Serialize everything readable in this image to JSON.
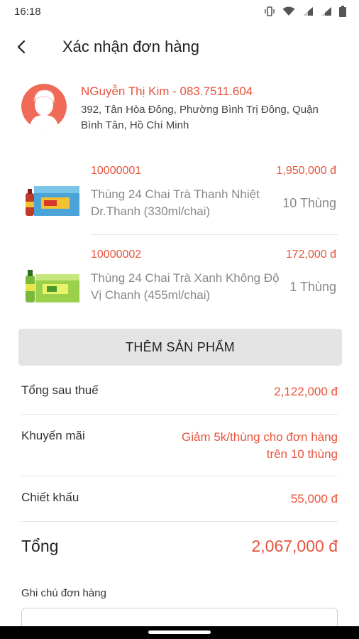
{
  "status_bar": {
    "time": "16:18"
  },
  "header": {
    "title": "Xác nhận đơn hàng"
  },
  "customer": {
    "name": "NGuyễn Thị Kim - 083.7511.604",
    "address": "392, Tân Hòa Đông, Phường Bình Trị Đông, Quận Bình Tân, Hồ Chí Minh"
  },
  "products": [
    {
      "sku": "10000001",
      "price": "1,950,000 đ",
      "name": "Thùng 24 Chai Trà Thanh Nhiệt Dr.Thanh (330ml/chai)",
      "quantity": "10 Thùng"
    },
    {
      "sku": "10000002",
      "price": "172,000 đ",
      "name": "Thùng 24 Chai Trà Xanh Không Độ Vị Chanh (455ml/chai)",
      "quantity": "1 Thùng"
    }
  ],
  "add_product_label": "THÊM SẢN PHẨM",
  "summary": {
    "after_tax_label": "Tổng sau thuế",
    "after_tax_value": "2,122,000 đ",
    "promotion_label": "Khuyến mãi",
    "promotion_value": "Giảm 5k/thùng cho đơn hàng trên 10 thùng",
    "discount_label": "Chiết khấu",
    "discount_value": "55,000 đ",
    "total_label": "Tổng",
    "total_value": "2,067,000 đ"
  },
  "note": {
    "label": "Ghi chú đơn hàng"
  },
  "colors": {
    "accent": "#e8533c",
    "button_bg": "#e4e4e4"
  }
}
